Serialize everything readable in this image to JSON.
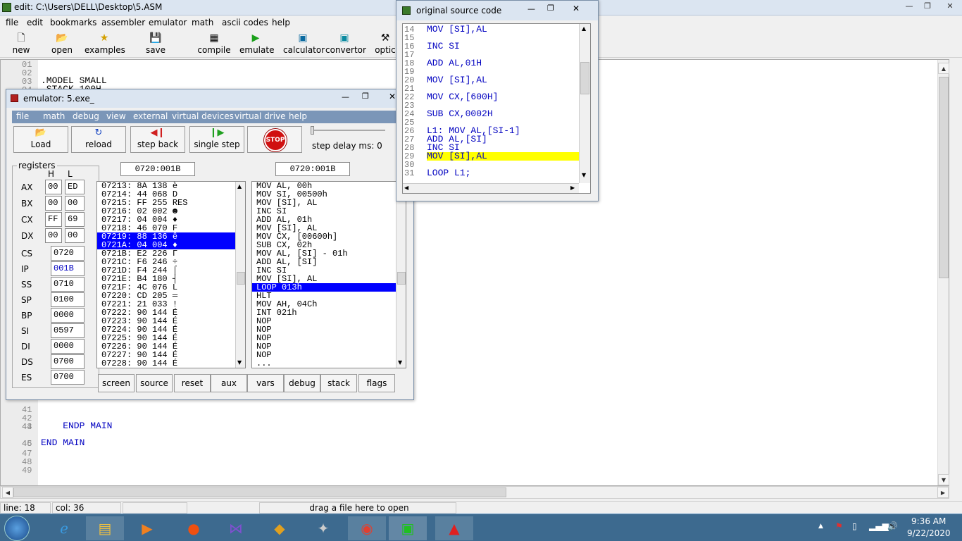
{
  "main_window": {
    "title": "edit: C:\\Users\\DELL\\Desktop\\5.ASM",
    "menu": [
      "file",
      "edit",
      "bookmarks",
      "assembler",
      "emulator",
      "math",
      "ascii codes",
      "help"
    ],
    "toolbar": [
      "new",
      "open",
      "examples",
      "save",
      "compile",
      "emulate",
      "calculator",
      "convertor",
      "optic"
    ],
    "editor_lines_top": [
      {
        "n": "01",
        "code": ""
      },
      {
        "n": "02",
        "code": ""
      },
      {
        "n": "03",
        "code": ".MODEL SMALL"
      },
      {
        "n": "04",
        "code": ".STACK 100H"
      }
    ],
    "editor_lines_bottom": [
      {
        "n": "41",
        "code": ""
      },
      {
        "n": "42",
        "code": ""
      },
      {
        "n": "43",
        "code": ""
      },
      {
        "n": "44",
        "code": "    ENDP MAIN"
      },
      {
        "n": "45",
        "code": ""
      },
      {
        "n": "46",
        "code": "END MAIN"
      },
      {
        "n": "47",
        "code": ""
      },
      {
        "n": "48",
        "code": ""
      },
      {
        "n": "49",
        "code": ""
      }
    ],
    "status": {
      "line": "line: 18",
      "col": "col: 36",
      "hint": "drag a file here to open"
    }
  },
  "emulator": {
    "title": "emulator: 5.exe_",
    "menu": [
      "file",
      "math",
      "debug",
      "view",
      "external",
      "virtual devices",
      "virtual drive",
      "help"
    ],
    "buttons": {
      "load": "Load",
      "reload": "reload",
      "step_back": "step back",
      "single_step": "single step",
      "stop": "STOP",
      "step_delay": "step delay ms: 0"
    },
    "registers_label": "registers",
    "hl": {
      "h": "H",
      "l": "L"
    },
    "regs_split": [
      {
        "name": "AX",
        "h": "00",
        "l": "ED"
      },
      {
        "name": "BX",
        "h": "00",
        "l": "00"
      },
      {
        "name": "CX",
        "h": "FF",
        "l": "69"
      },
      {
        "name": "DX",
        "h": "00",
        "l": "00"
      }
    ],
    "regs_full": [
      {
        "name": "CS",
        "v": "0720"
      },
      {
        "name": "IP",
        "v": "001B"
      },
      {
        "name": "SS",
        "v": "0710"
      },
      {
        "name": "SP",
        "v": "0100"
      },
      {
        "name": "BP",
        "v": "0000"
      },
      {
        "name": "SI",
        "v": "0597"
      },
      {
        "name": "DI",
        "v": "0000"
      },
      {
        "name": "DS",
        "v": "0700"
      },
      {
        "name": "ES",
        "v": "0700"
      }
    ],
    "addr_left": "0720:001B",
    "addr_right": "0720:001B",
    "memory": [
      "07213: 8A 138 è",
      "07214: 44 068 D",
      "07215: FF 255 RES",
      "07216: 02 002 ☻",
      "07217: 04 004 ♦",
      "07218: 46 070 F",
      "07219: 88 136 ê",
      "0721A: 04 004 ♦",
      "0721B: E2 226 Γ",
      "0721C: F6 246 ÷",
      "0721D: F4 244 ⌠",
      "0721E: B4 180 ┤",
      "0721F: 4C 076 L",
      "07220: CD 205 ═",
      "07221: 21 033 !",
      "07222: 90 144 É",
      "07223: 90 144 É",
      "07224: 90 144 É",
      "07225: 90 144 É",
      "07226: 90 144 É",
      "07227: 90 144 É",
      "07228: 90 144 É"
    ],
    "disasm": [
      "MOV AL, 00h",
      "MOV SI, 00500h",
      "MOV [SI], AL",
      "INC SI",
      "ADD AL, 01h",
      "MOV [SI], AL",
      "MOV CX, [00600h]",
      "SUB CX, 02h",
      "MOV AL, [SI] - 01h",
      "ADD AL, [SI]",
      "INC SI",
      "MOV [SI], AL",
      "LOOP 013h",
      "HLT",
      "MOV AH, 04Ch",
      "INT 021h",
      "NOP",
      "NOP",
      "NOP",
      "NOP",
      "NOP",
      "..."
    ],
    "bottom_buttons": [
      "screen",
      "source",
      "reset",
      "aux",
      "vars",
      "debug",
      "stack",
      "flags"
    ]
  },
  "source_window": {
    "title": "original source code",
    "lines": [
      {
        "n": "14",
        "code": "MOV [SI],AL"
      },
      {
        "n": "15",
        "code": ""
      },
      {
        "n": "16",
        "code": "INC SI"
      },
      {
        "n": "17",
        "code": ""
      },
      {
        "n": "18",
        "code": "ADD AL,01H"
      },
      {
        "n": "19",
        "code": ""
      },
      {
        "n": "20",
        "code": "MOV [SI],AL"
      },
      {
        "n": "21",
        "code": ""
      },
      {
        "n": "22",
        "code": "MOV CX,[600H]"
      },
      {
        "n": "23",
        "code": ""
      },
      {
        "n": "24",
        "code": "SUB CX,0002H"
      },
      {
        "n": "25",
        "code": ""
      },
      {
        "n": "26",
        "code": "L1: MOV AL,[SI-1]"
      },
      {
        "n": "27",
        "code": "ADD AL,[SI]"
      },
      {
        "n": "28",
        "code": "INC SI"
      },
      {
        "n": "29",
        "code": "MOV [SI],AL"
      },
      {
        "n": "30",
        "code": ""
      },
      {
        "n": "31",
        "code": "LOOP L1;"
      }
    ]
  },
  "taskbar": {
    "time": "9:36 AM",
    "date": "9/22/2020"
  }
}
